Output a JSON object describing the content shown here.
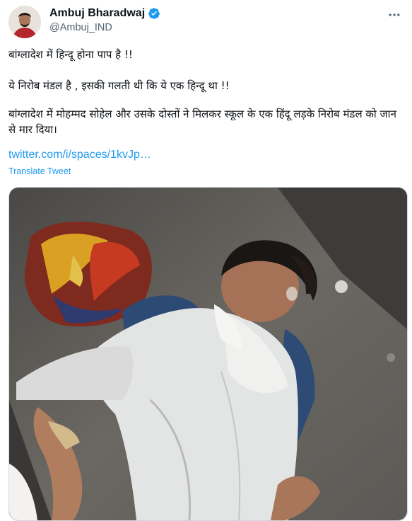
{
  "tweet": {
    "author_name": "Ambuj Bharadwaj",
    "handle": "@Ambuj_IND",
    "paragraphs": [
      "बांग्लादेश में हिन्दू होना पाप है !!",
      "ये निरोब मंडल है , इसकी गलती थी कि ये एक हिन्दू था !!",
      "बांग्लादेश में मोहम्मद सोहेल और उसके दोस्तों ने मिलकर स्कूल के एक हिंदू लड़के निरोब मंडल को जान से मार दिया।"
    ],
    "link": "twitter.com/i/spaces/1kvJp…",
    "translate_label": "Translate Tweet",
    "icons": {
      "verified": "verified-badge-icon",
      "more": "more-options-icon"
    },
    "colors": {
      "link": "#1d9bf0",
      "secondary_text": "#536471",
      "verified": "#1d9bf0"
    }
  }
}
